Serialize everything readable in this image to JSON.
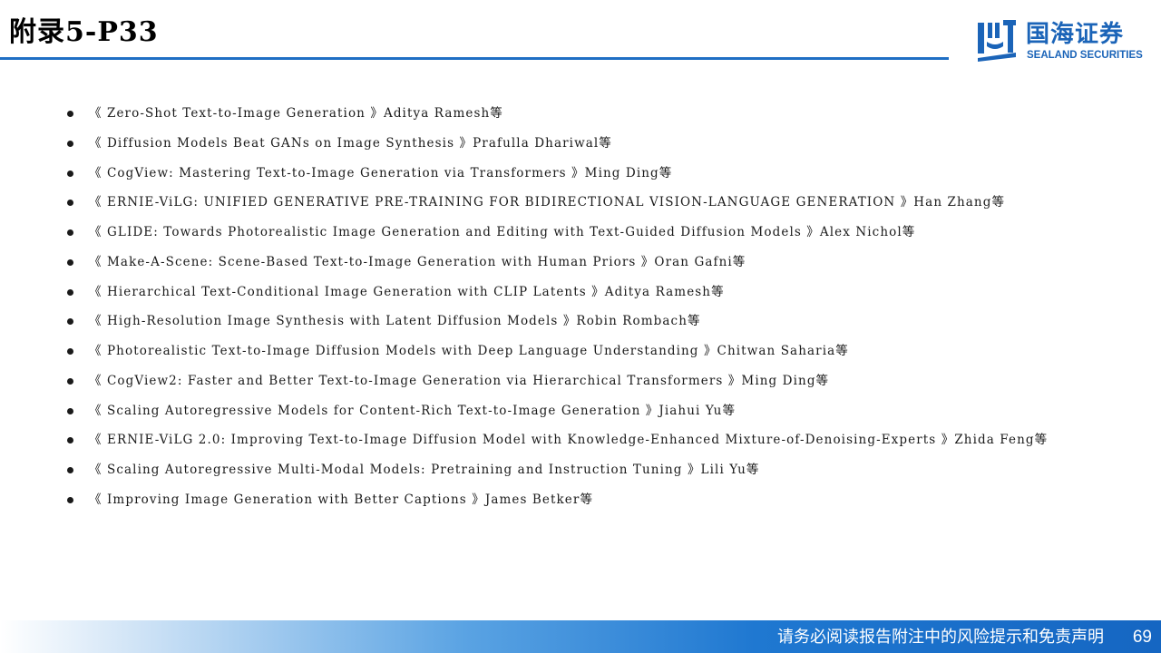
{
  "header": {
    "title": "附录5-P33"
  },
  "logo": {
    "name_cn": "国海证券",
    "name_en": "SEALAND SECURITIES",
    "color": "#1b64b8"
  },
  "references": [
    "《 Zero-Shot Text-to-Image Generation 》Aditya Ramesh等",
    "《 Diffusion Models Beat GANs on Image Synthesis 》Prafulla Dhariwal等",
    "《 CogView: Mastering Text-to-Image Generation via Transformers 》Ming Ding等",
    "《 ERNIE-ViLG: UNIFIED GENERATIVE PRE-TRAINING FOR BIDIRECTIONAL VISION-LANGUAGE GENERATION 》Han Zhang等",
    "《 GLIDE: Towards Photorealistic Image Generation and Editing with Text-Guided Diffusion Models 》Alex Nichol等",
    "《 Make-A-Scene: Scene-Based Text-to-Image Generation with Human Priors 》Oran Gafni等",
    "《 Hierarchical Text-Conditional Image Generation with CLIP Latents 》Aditya Ramesh等",
    "《 High-Resolution Image Synthesis with Latent Diffusion Models 》Robin Rombach等",
    "《 Photorealistic Text-to-Image Diffusion Models with Deep Language Understanding 》Chitwan Saharia等",
    "《 CogView2: Faster and Better Text-to-Image Generation via Hierarchical Transformers 》Ming Ding等",
    "《 Scaling Autoregressive Models for Content-Rich Text-to-Image Generation 》Jiahui Yu等",
    "《 ERNIE-ViLG 2.0: Improving Text-to-Image Diffusion Model with Knowledge-Enhanced Mixture-of-Denoising-Experts 》Zhida Feng等",
    "《 Scaling Autoregressive Multi-Modal Models: Pretraining and Instruction Tuning 》Lili Yu等",
    "《 Improving Image Generation with Better Captions 》James Betker等"
  ],
  "footer": {
    "disclaimer": "请务必阅读报告附注中的风险提示和免责声明",
    "page_number": "69"
  },
  "colors": {
    "accent": "#1f6fc4",
    "footer_blue": "#1566c2"
  }
}
